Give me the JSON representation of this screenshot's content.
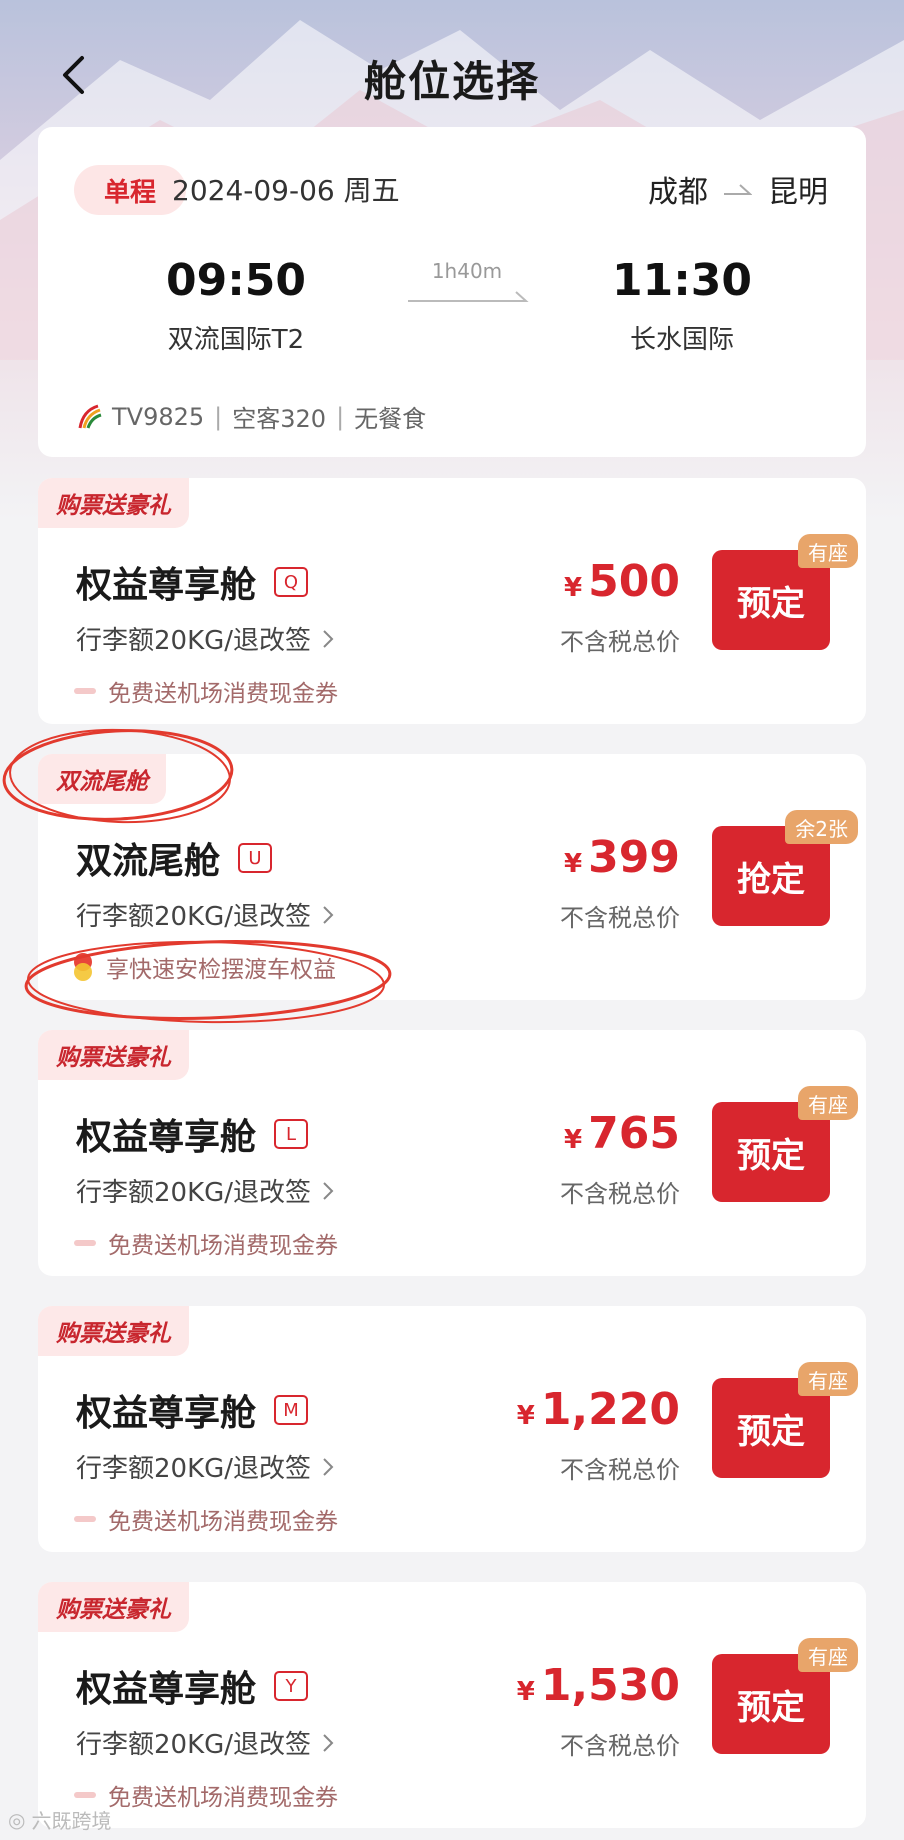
{
  "header": {
    "title": "舱位选择"
  },
  "flight": {
    "trip_type": "单程",
    "date": "2024-09-06 周五",
    "from_city": "成都",
    "to_city": "昆明",
    "dep_time": "09:50",
    "arr_time": "11:30",
    "dep_airport": "双流国际T2",
    "arr_airport": "长水国际",
    "duration": "1h40m",
    "flight_no": "TV9825",
    "aircraft": "空客320",
    "meal": "无餐食"
  },
  "cabins": [
    {
      "tag": "购票送豪礼",
      "name": "权益尊享舱",
      "code": "Q",
      "baggage": "行李额20KG/退改签",
      "benefit": "免费送机场消费现金券",
      "price": "500",
      "tax_note": "不含税总价",
      "button": "预定",
      "seat": "有座"
    },
    {
      "tag": "双流尾舱",
      "name": "双流尾舱",
      "code": "U",
      "baggage": "行李额20KG/退改签",
      "benefit": "享快速安检摆渡车权益",
      "price": "399",
      "tax_note": "不含税总价",
      "button": "抢定",
      "seat": "余2张"
    },
    {
      "tag": "购票送豪礼",
      "name": "权益尊享舱",
      "code": "L",
      "baggage": "行李额20KG/退改签",
      "benefit": "免费送机场消费现金券",
      "price": "765",
      "tax_note": "不含税总价",
      "button": "预定",
      "seat": "有座"
    },
    {
      "tag": "购票送豪礼",
      "name": "权益尊享舱",
      "code": "M",
      "baggage": "行李额20KG/退改签",
      "benefit": "免费送机场消费现金券",
      "price": "1,220",
      "tax_note": "不含税总价",
      "button": "预定",
      "seat": "有座"
    },
    {
      "tag": "购票送豪礼",
      "name": "权益尊享舱",
      "code": "Y",
      "baggage": "行李额20KG/退改签",
      "benefit": "免费送机场消费现金券",
      "price": "1,530",
      "tax_note": "不含税总价",
      "button": "预定",
      "seat": "有座"
    }
  ],
  "currency": "¥",
  "watermark": "六既跨境",
  "colors": {
    "accent": "#d8262e",
    "seat_badge": "#e8a56a",
    "tag_bg": "#fde8e8"
  }
}
